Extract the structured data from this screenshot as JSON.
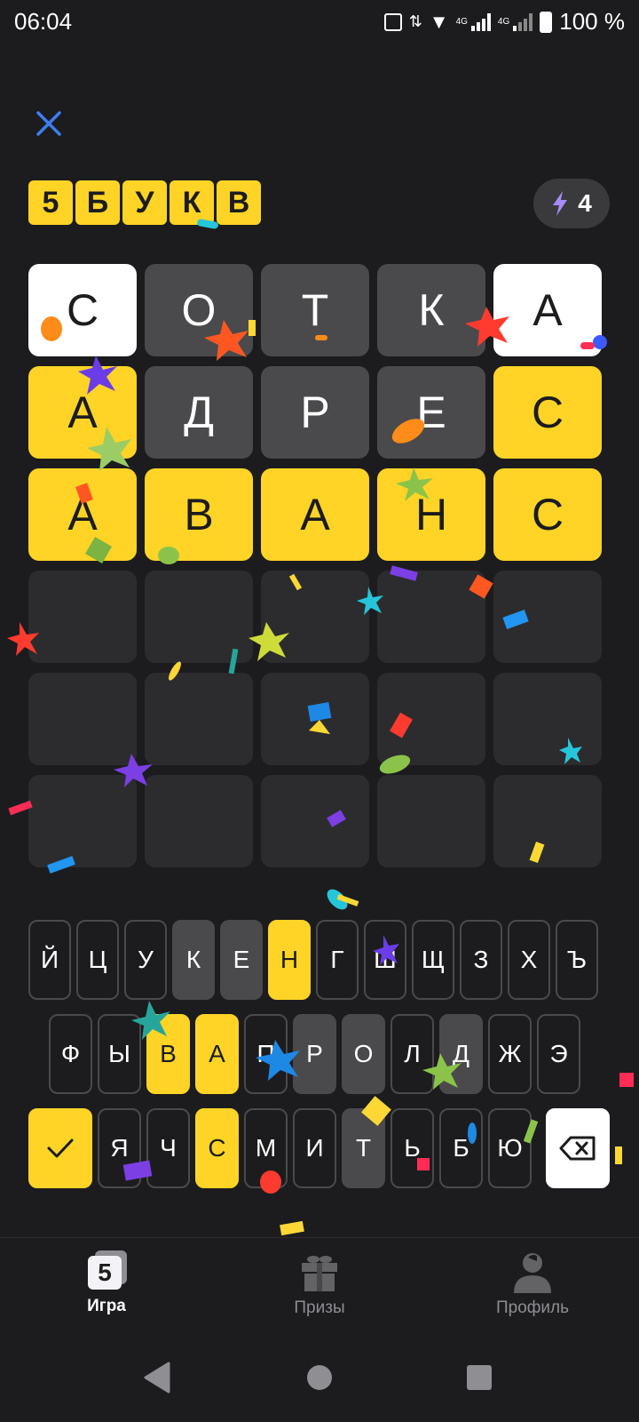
{
  "status_bar": {
    "time": "06:04",
    "network_1": "4G",
    "network_2": "4G",
    "battery": "100 %"
  },
  "header": {
    "logo_letters": [
      "5",
      "Б",
      "У",
      "К",
      "В"
    ],
    "hints_count": "4"
  },
  "board": {
    "rows": [
      [
        {
          "l": "С",
          "s": "present"
        },
        {
          "l": "О",
          "s": "absent"
        },
        {
          "l": "Т",
          "s": "absent"
        },
        {
          "l": "К",
          "s": "absent"
        },
        {
          "l": "А",
          "s": "present"
        }
      ],
      [
        {
          "l": "А",
          "s": "correct"
        },
        {
          "l": "Д",
          "s": "absent"
        },
        {
          "l": "Р",
          "s": "absent"
        },
        {
          "l": "Е",
          "s": "absent"
        },
        {
          "l": "С",
          "s": "correct"
        }
      ],
      [
        {
          "l": "А",
          "s": "correct"
        },
        {
          "l": "В",
          "s": "correct"
        },
        {
          "l": "А",
          "s": "correct"
        },
        {
          "l": "Н",
          "s": "correct"
        },
        {
          "l": "С",
          "s": "correct"
        }
      ],
      [
        {
          "l": "",
          "s": "empty"
        },
        {
          "l": "",
          "s": "empty"
        },
        {
          "l": "",
          "s": "empty"
        },
        {
          "l": "",
          "s": "empty"
        },
        {
          "l": "",
          "s": "empty"
        }
      ],
      [
        {
          "l": "",
          "s": "empty"
        },
        {
          "l": "",
          "s": "empty"
        },
        {
          "l": "",
          "s": "empty"
        },
        {
          "l": "",
          "s": "empty"
        },
        {
          "l": "",
          "s": "empty"
        }
      ],
      [
        {
          "l": "",
          "s": "empty"
        },
        {
          "l": "",
          "s": "empty"
        },
        {
          "l": "",
          "s": "empty"
        },
        {
          "l": "",
          "s": "empty"
        },
        {
          "l": "",
          "s": "empty"
        }
      ]
    ]
  },
  "keyboard": {
    "rows": [
      [
        {
          "k": "Й",
          "s": ""
        },
        {
          "k": "Ц",
          "s": ""
        },
        {
          "k": "У",
          "s": ""
        },
        {
          "k": "К",
          "s": "absent"
        },
        {
          "k": "Е",
          "s": "absent"
        },
        {
          "k": "Н",
          "s": "correct"
        },
        {
          "k": "Г",
          "s": ""
        },
        {
          "k": "Ш",
          "s": ""
        },
        {
          "k": "Щ",
          "s": ""
        },
        {
          "k": "З",
          "s": ""
        },
        {
          "k": "Х",
          "s": ""
        },
        {
          "k": "Ъ",
          "s": ""
        }
      ],
      [
        {
          "k": "Ф",
          "s": ""
        },
        {
          "k": "Ы",
          "s": ""
        },
        {
          "k": "В",
          "s": "correct"
        },
        {
          "k": "А",
          "s": "correct"
        },
        {
          "k": "П",
          "s": ""
        },
        {
          "k": "Р",
          "s": "absent"
        },
        {
          "k": "О",
          "s": "absent"
        },
        {
          "k": "Л",
          "s": ""
        },
        {
          "k": "Д",
          "s": "absent"
        },
        {
          "k": "Ж",
          "s": ""
        },
        {
          "k": "Э",
          "s": ""
        }
      ],
      [
        {
          "k": "Я",
          "s": ""
        },
        {
          "k": "Ч",
          "s": ""
        },
        {
          "k": "С",
          "s": "correct"
        },
        {
          "k": "М",
          "s": ""
        },
        {
          "k": "И",
          "s": ""
        },
        {
          "k": "Т",
          "s": "absent"
        },
        {
          "k": "Ь",
          "s": ""
        },
        {
          "k": "Б",
          "s": ""
        },
        {
          "k": "Ю",
          "s": ""
        }
      ]
    ],
    "enter_icon": "checkmark-icon",
    "backspace_icon": "backspace-icon"
  },
  "bottom_nav": {
    "items": [
      {
        "label": "Игра",
        "icon": "game-5-icon",
        "active": true
      },
      {
        "label": "Призы",
        "icon": "gift-icon",
        "active": false
      },
      {
        "label": "Профиль",
        "icon": "profile-icon",
        "active": false
      }
    ]
  },
  "colors": {
    "background": "#1c1c1e",
    "correct": "#ffd426",
    "present": "#ffffff",
    "absent": "#4a4a4c",
    "empty": "#2c2c2e",
    "close_icon": "#3d7ef0",
    "hint_bolt": "#a78bfa"
  }
}
